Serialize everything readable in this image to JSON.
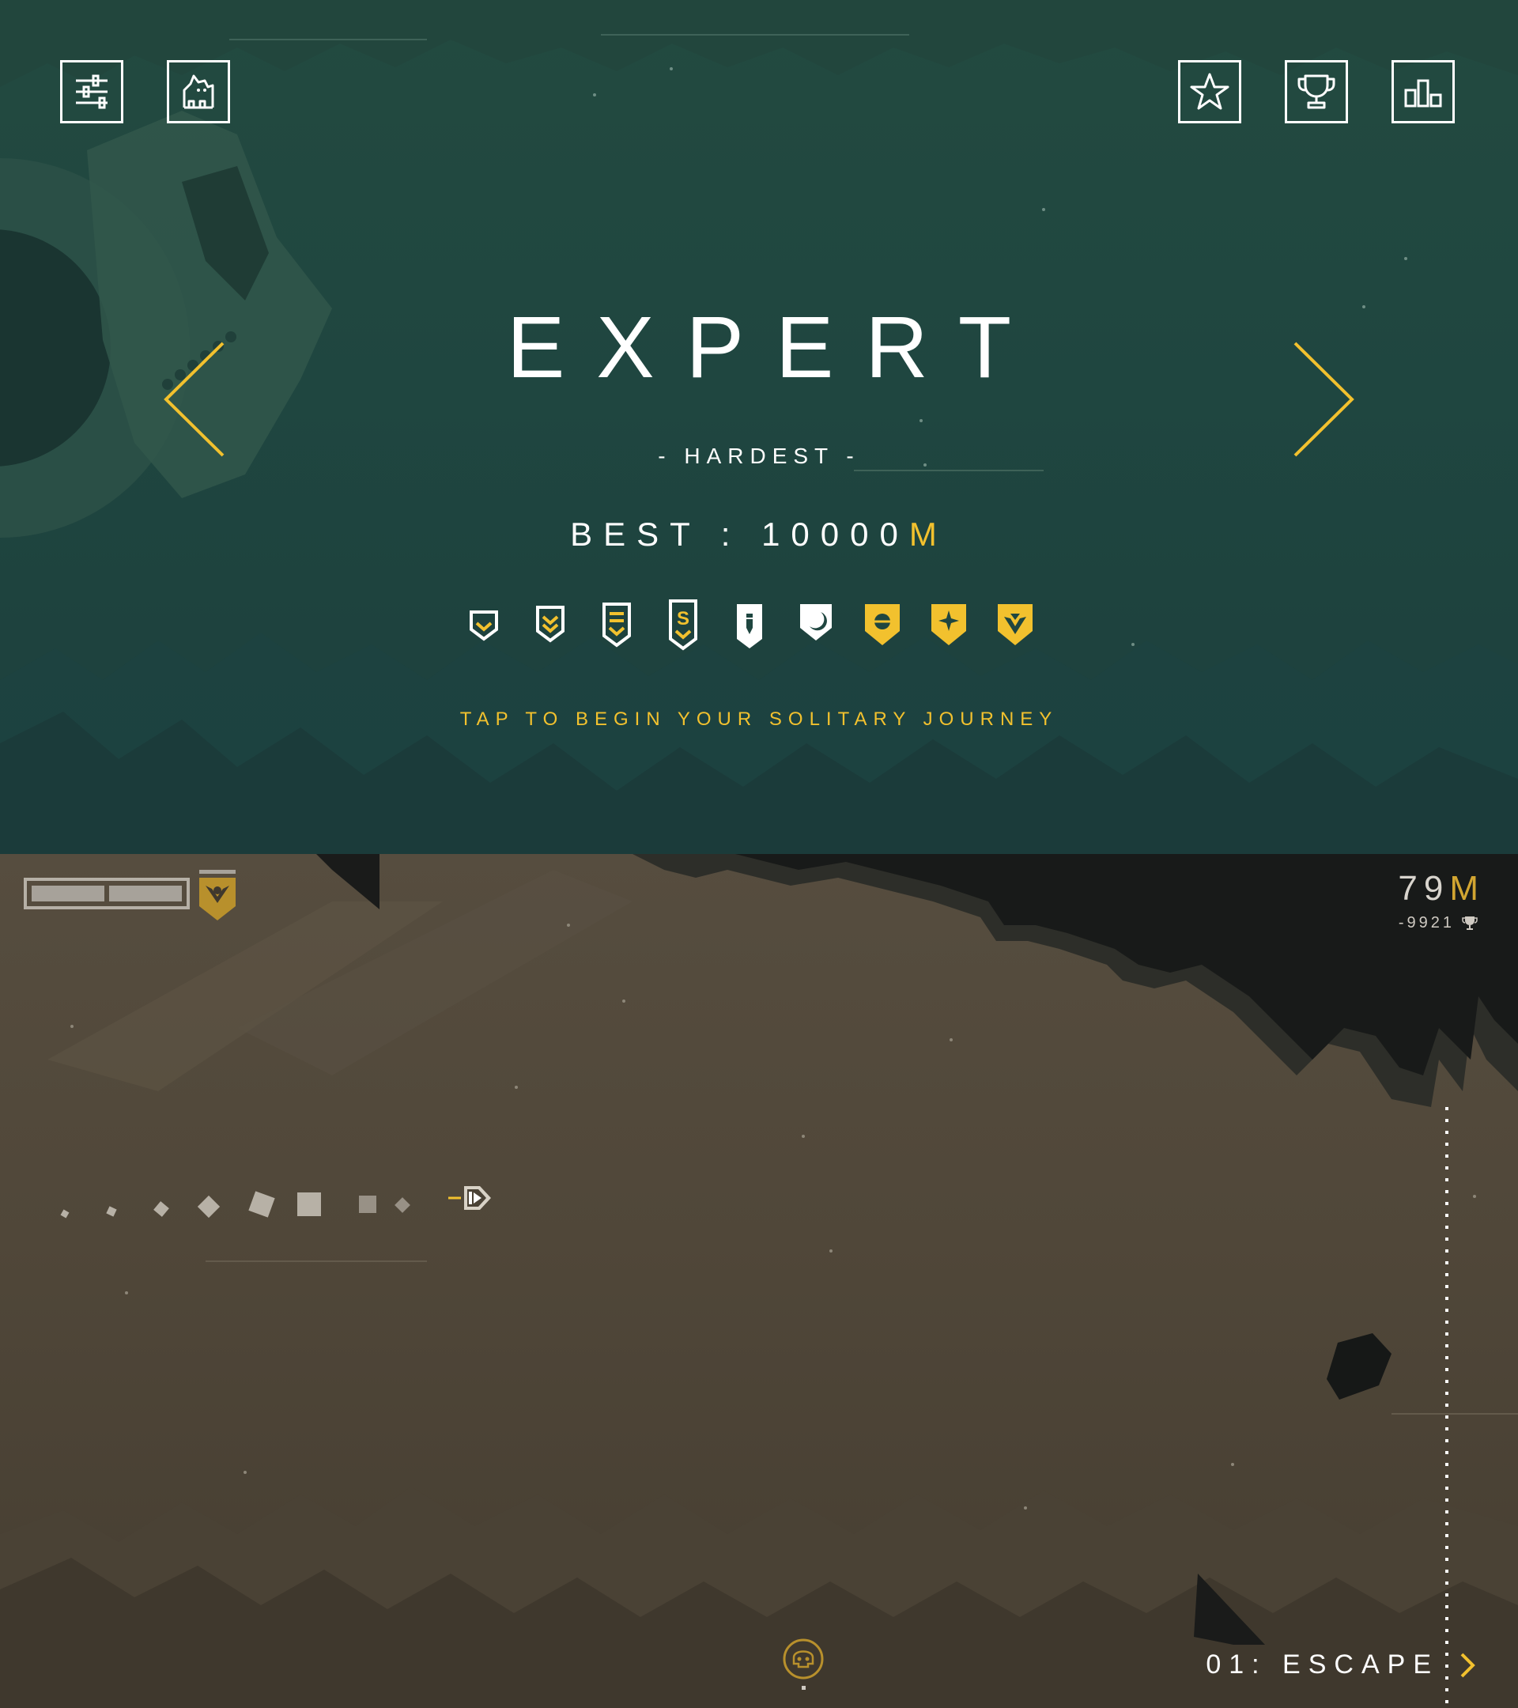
{
  "menu": {
    "mode_title": "EXPERT",
    "mode_subtitle": "- HARDEST -",
    "best_label": "BEST : 10000",
    "best_unit": "M",
    "tap_prompt": "TAP TO BEGIN YOUR SOLITARY JOURNEY",
    "buttons": [
      {
        "name": "settings-button",
        "icon": "sliders-icon"
      },
      {
        "name": "character-button",
        "icon": "cat-icon"
      },
      {
        "name": "favorites-button",
        "icon": "star-icon"
      },
      {
        "name": "achievements-button",
        "icon": "trophy-icon"
      },
      {
        "name": "leaderboard-button",
        "icon": "podium-icon"
      }
    ],
    "nav_arrows": [
      "chevron-left-icon",
      "chevron-right-icon"
    ],
    "rank_badges": [
      {
        "icon": "chevron-single-badge",
        "unlocked": false
      },
      {
        "icon": "chevron-double-badge",
        "unlocked": false
      },
      {
        "icon": "bars-chevron-badge",
        "unlocked": false
      },
      {
        "icon": "s-chevron-badge",
        "unlocked": false
      },
      {
        "icon": "pen-badge",
        "unlocked": false
      },
      {
        "icon": "moon-badge",
        "unlocked": false
      },
      {
        "icon": "sun-badge",
        "unlocked": true
      },
      {
        "icon": "star-badge",
        "unlocked": true
      },
      {
        "icon": "wings-badge",
        "unlocked": true
      }
    ]
  },
  "hud": {
    "health_segments_filled": 2,
    "health_segments_total": 2,
    "distance": "79",
    "distance_unit": "M",
    "best_remaining": "-9921",
    "level_label": "01: ESCAPE"
  },
  "colors": {
    "accent_yellow": "#f2c12e",
    "menu_bg": "#1f4640",
    "game_bg": "#504739",
    "dark_rock": "#1a1c1c"
  }
}
